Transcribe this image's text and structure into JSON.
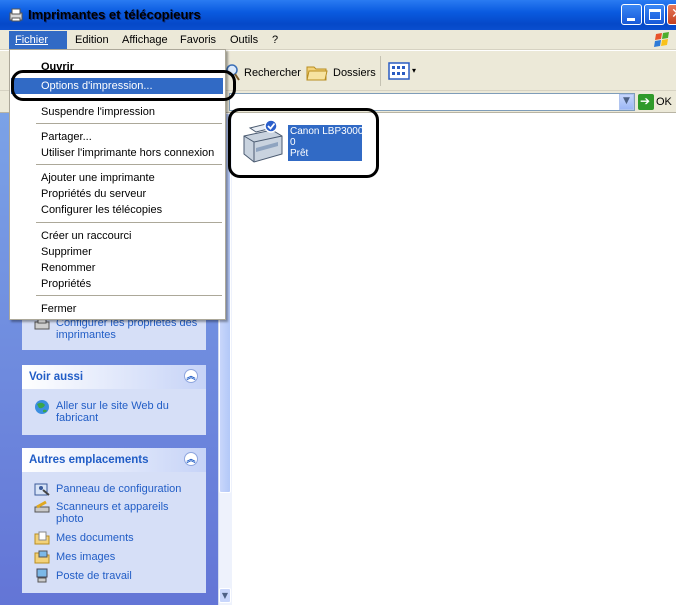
{
  "window": {
    "title": "Imprimantes et télécopieurs"
  },
  "menubar": {
    "items": [
      "Fichier",
      "Edition",
      "Affichage",
      "Favoris",
      "Outils",
      "?"
    ]
  },
  "toolbar": {
    "search_label": "Rechercher",
    "folders_label": "Dossiers"
  },
  "address": {
    "go_label": "OK"
  },
  "file_menu": {
    "items": [
      "Ouvrir",
      "Options d'impression...",
      "Suspendre l'impression",
      "Partager...",
      "Utiliser l'imprimante hors connexion",
      "Ajouter une imprimante",
      "Propriétés du serveur",
      "Configurer les télécopies",
      "Créer un raccourci",
      "Supprimer",
      "Renommer",
      "Propriétés",
      "Fermer"
    ]
  },
  "left_panel": {
    "partial_task": "Configurer les propriétés des imprimantes",
    "see_also": {
      "header": "Voir aussi",
      "links": [
        "Aller sur le site Web du fabricant"
      ]
    },
    "other_places": {
      "header": "Autres emplacements",
      "links": [
        "Panneau de configuration",
        "Scanneurs et appareils photo",
        "Mes documents",
        "Mes images",
        "Poste de travail"
      ]
    }
  },
  "printer": {
    "name": "Canon LBP3000",
    "jobs": "0",
    "status": "Prêt"
  },
  "colors": {
    "titlebar": "#0a5be0",
    "selection": "#316ac5",
    "panel": "#7ba2e7"
  }
}
